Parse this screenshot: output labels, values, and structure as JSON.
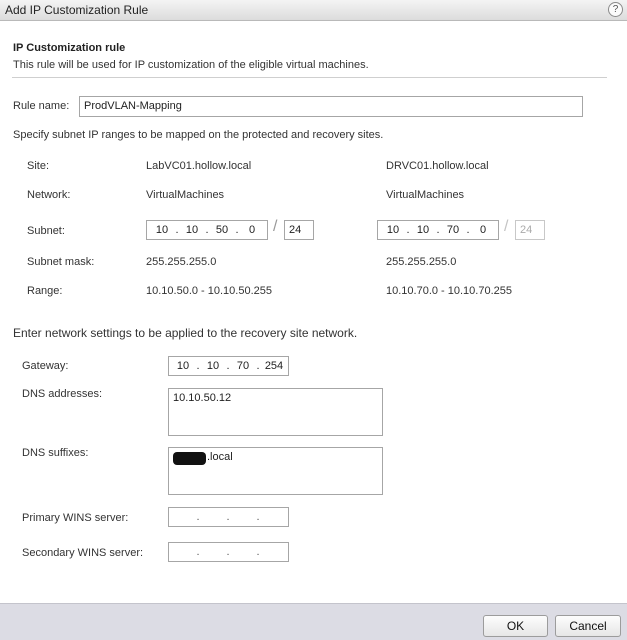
{
  "dialog": {
    "title": "Add IP Customization Rule",
    "help_glyph": "?"
  },
  "header": {
    "title": "IP Customization rule",
    "subtitle": "This rule will be used for IP customization of the eligible virtual machines."
  },
  "rule": {
    "label": "Rule name:",
    "value": "ProdVLAN-Mapping"
  },
  "subnet_section": {
    "instruction": "Specify subnet IP ranges to be mapped on the protected and recovery sites.",
    "labels": {
      "site": "Site:",
      "network": "Network:",
      "subnet": "Subnet:",
      "mask": "Subnet mask:",
      "range": "Range:"
    },
    "protected": {
      "site": "LabVC01.hollow.local",
      "network": "VirtualMachines",
      "subnet_octets": [
        "10",
        "10",
        "50",
        "0"
      ],
      "prefix": "24",
      "mask": "255.255.255.0",
      "range": "10.10.50.0 - 10.10.50.255"
    },
    "recovery": {
      "site": "DRVC01.hollow.local",
      "network": "VirtualMachines",
      "subnet_octets": [
        "10",
        "10",
        "70",
        "0"
      ],
      "prefix": "24",
      "mask": "255.255.255.0",
      "range": "10.10.70.0 - 10.10.70.255"
    },
    "slash": "/"
  },
  "network_section": {
    "instruction": "Enter network settings to be applied to the recovery site network.",
    "gateway": {
      "label": "Gateway:",
      "octets": [
        "10",
        "10",
        "70",
        "254"
      ]
    },
    "dns_addresses": {
      "label": "DNS addresses:",
      "value": "10.10.50.12"
    },
    "dns_suffixes": {
      "label": "DNS suffixes:",
      "value": ".local"
    },
    "primary_wins": {
      "label": "Primary WINS server:"
    },
    "secondary_wins": {
      "label": "Secondary WINS server:"
    }
  },
  "ip_dot": ".",
  "footer": {
    "ok_label": "OK",
    "cancel_label": "Cancel"
  }
}
